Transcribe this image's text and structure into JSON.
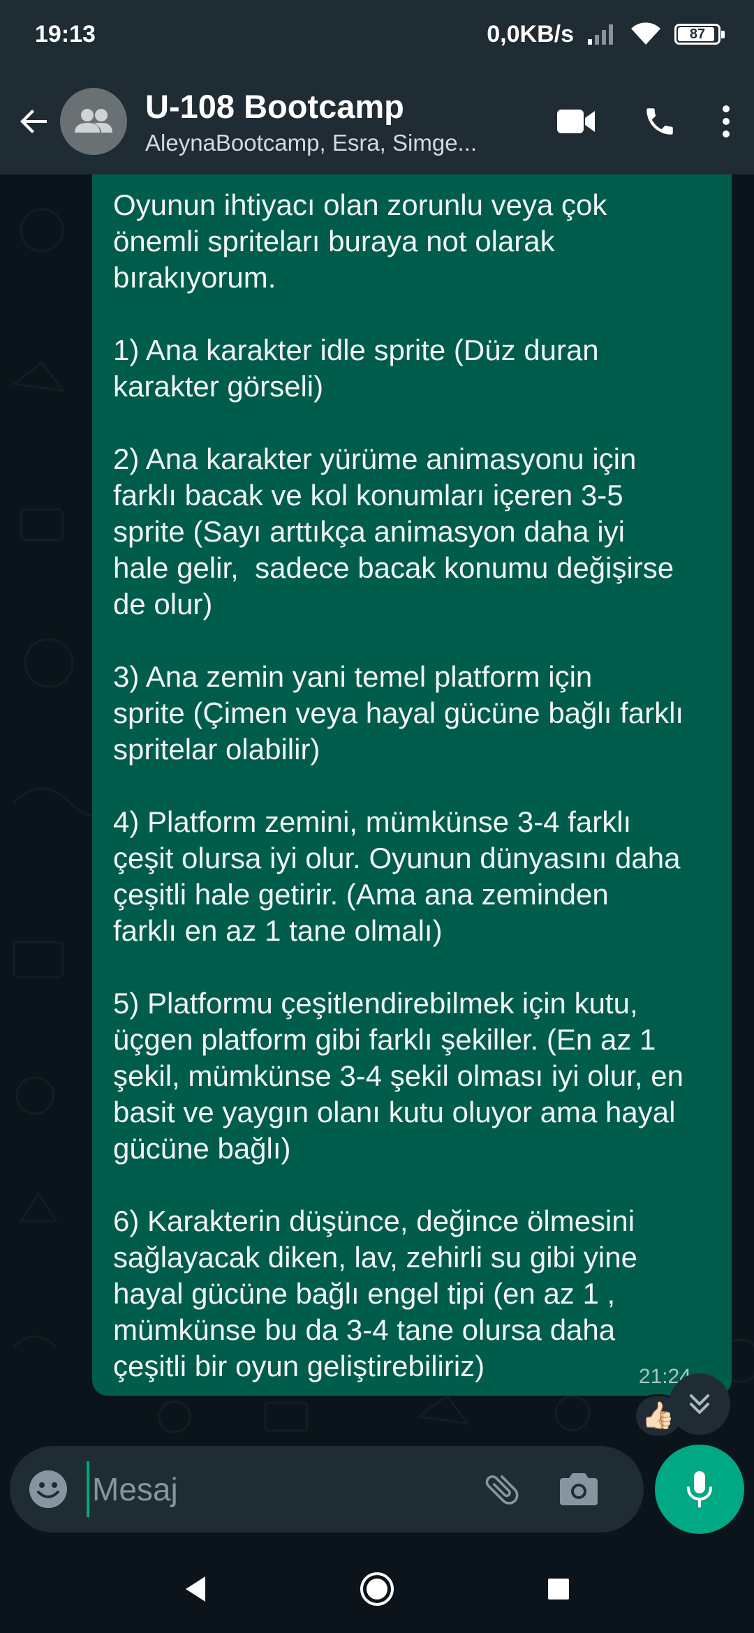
{
  "status_bar": {
    "time": "19:13",
    "network_speed": "0,0KB/s",
    "battery_level": "87"
  },
  "header": {
    "title": "U-108 Bootcamp",
    "subtitle": "AleynaBootcamp, Esra, Simge..."
  },
  "chat": {
    "messages": [
      {
        "text": "Oyunun ihtiyacı olan zorunlu veya çok\nönemli spriteları buraya not olarak\nbırakıyorum.\n\n1) Ana karakter idle sprite (Düz duran\nkarakter görseli)\n\n2) Ana karakter yürüme animasyonu için\nfarklı bacak ve kol konumları içeren 3-5\nsprite (Sayı arttıkça animasyon daha iyi\nhale gelir,  sadece bacak konumu değişirse\nde olur)\n\n3) Ana zemin yani temel platform için\nsprite (Çimen veya hayal gücüne bağlı farklı\nspritelar olabilir)\n\n4) Platform zemini, mümkünse 3-4 farklı\nçeşit olursa iyi olur. Oyunun dünyasını daha\nçeşitli hale getirir. (Ama ana zeminden\nfarklı en az 1 tane olmalı)\n\n5) Platformu çeşitlendirebilmek için kutu,\nüçgen platform gibi farklı şekiller. (En az 1\nşekil, mümkünse 3-4 şekil olması iyi olur, en\nbasit ve yaygın olanı kutu oluyor ama hayal\ngücüne bağlı)\n\n6) Karakterin düşünce, değince ölmesini\nsağlayacak diken, lav, zehirli su gibi yine\nhayal gücüne bağlı engel tipi (en az 1 ,\nmümkünse bu da 3-4 tane olursa daha\nçeşitli bir oyun geliştirebiliriz)",
        "time": "21:24",
        "reaction": "👍🏻"
      }
    ]
  },
  "composer": {
    "placeholder": "Mesaj"
  },
  "colors": {
    "header_bg": "#1f2c34",
    "chat_bg": "#0b141a",
    "outgoing_bubble": "#005c4b",
    "accent": "#00a884"
  },
  "icons": [
    "back-arrow-icon",
    "group-avatar-icon",
    "video-call-icon",
    "phone-icon",
    "more-vert-icon",
    "emoji-icon",
    "attach-icon",
    "camera-icon",
    "mic-icon",
    "scroll-down-icon",
    "nav-back-icon",
    "nav-home-icon",
    "nav-recents-icon",
    "signal-icon",
    "wifi-icon",
    "battery-icon"
  ]
}
